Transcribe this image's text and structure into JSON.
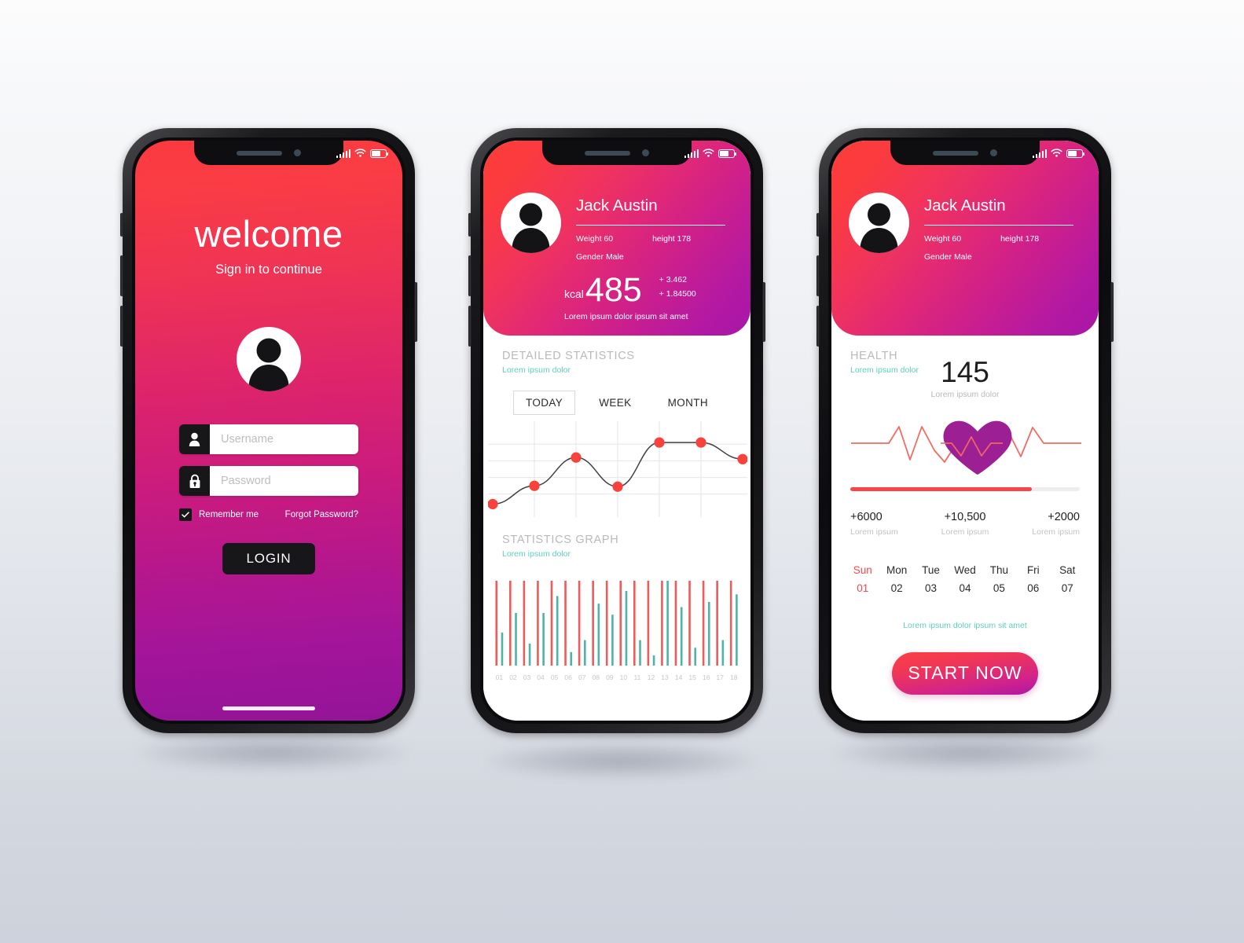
{
  "theme": {
    "accent_red": "#f8454b",
    "accent_magenta": "#b419a2",
    "accent_teal": "#5ecfc0",
    "heart_purple": "#9c1f93",
    "bar_red": "#ee5b5b",
    "bar_teal": "#4fb3a8"
  },
  "screen_login": {
    "title": "welcome",
    "subtitle": "Sign in to continue",
    "avatar_icon": "user-avatar-icon",
    "username": {
      "placeholder": "Username",
      "value": "",
      "icon": "user-icon"
    },
    "password": {
      "placeholder": "Password",
      "value": "",
      "icon": "lock-icon"
    },
    "remember_label": "Remember me",
    "remember_checked": true,
    "forgot_label": "Forgot Password?",
    "login_label": "LOGIN"
  },
  "profile": {
    "name": "Jack Austin",
    "weight_label": "Weight 60",
    "height_label": "height 178",
    "gender_label": "Gender Male",
    "avatar_icon": "user-avatar-icon",
    "kcal_unit": "kcal",
    "kcal_value": "485",
    "delta_1": "+ 3.462",
    "delta_2": "+ 1.84500",
    "kcal_note": "Lorem ipsum dolor ipsum sit amet"
  },
  "screen_stats": {
    "detailed": {
      "title": "DETAILED STATISTICS",
      "subtitle": "Lorem ipsum dolor"
    },
    "tabs": [
      {
        "label": "TODAY",
        "active": true
      },
      {
        "label": "WEEK",
        "active": false
      },
      {
        "label": "MONTH",
        "active": false
      }
    ],
    "graph": {
      "title": "STATISTICS GRAPH",
      "subtitle": "Lorem ipsum dolor"
    }
  },
  "screen_health": {
    "title": "HEALTH",
    "subtitle": "Lorem ipsum dolor",
    "bpm_value": "145",
    "bpm_note": "Lorem ipsum dolor",
    "heart_icon": "heart-icon",
    "progress_percent": 79,
    "stats": [
      {
        "value": "+6000",
        "label": "Lorem ipsum"
      },
      {
        "value": "+10,500",
        "label": "Lorem ipsum"
      },
      {
        "value": "+2000",
        "label": "Lorem ipsum"
      }
    ],
    "days": [
      {
        "name": "Sun",
        "num": "01",
        "today": true
      },
      {
        "name": "Mon",
        "num": "02",
        "today": false
      },
      {
        "name": "Tue",
        "num": "03",
        "today": false
      },
      {
        "name": "Wed",
        "num": "04",
        "today": false
      },
      {
        "name": "Thu",
        "num": "05",
        "today": false
      },
      {
        "name": "Fri",
        "num": "06",
        "today": false
      },
      {
        "name": "Sat",
        "num": "07",
        "today": false
      }
    ],
    "note": "Lorem ipsum dolor ipsum sit amet",
    "start_label": "START NOW"
  },
  "chart_data": [
    {
      "type": "line",
      "title": "DETAILED STATISTICS",
      "x": [
        1,
        2,
        3,
        4,
        5,
        6,
        7
      ],
      "values": [
        8,
        30,
        64,
        29,
        82,
        82,
        62
      ],
      "ylim": [
        0,
        100
      ],
      "grid": true,
      "marker_color": "#f9423c",
      "line_color": "#3f3f44",
      "smooth": true,
      "xlabel": "",
      "ylabel": ""
    },
    {
      "type": "bar",
      "title": "STATISTICS GRAPH",
      "categories": [
        "01",
        "02",
        "03",
        "04",
        "05",
        "06",
        "07",
        "08",
        "09",
        "10",
        "11",
        "12",
        "13",
        "14",
        "15",
        "16",
        "17",
        "18"
      ],
      "series": [
        {
          "name": "red",
          "color": "#ee5b5b",
          "values": [
            100,
            100,
            100,
            100,
            100,
            100,
            100,
            100,
            100,
            100,
            100,
            100,
            100,
            100,
            100,
            100,
            100,
            100
          ]
        },
        {
          "name": "teal",
          "color": "#4fb3a8",
          "values": [
            39,
            62,
            26,
            62,
            82,
            16,
            30,
            73,
            60,
            88,
            30,
            12,
            100,
            69,
            21,
            75,
            30,
            84
          ]
        }
      ],
      "ylim": [
        0,
        100
      ],
      "grid": false
    }
  ]
}
